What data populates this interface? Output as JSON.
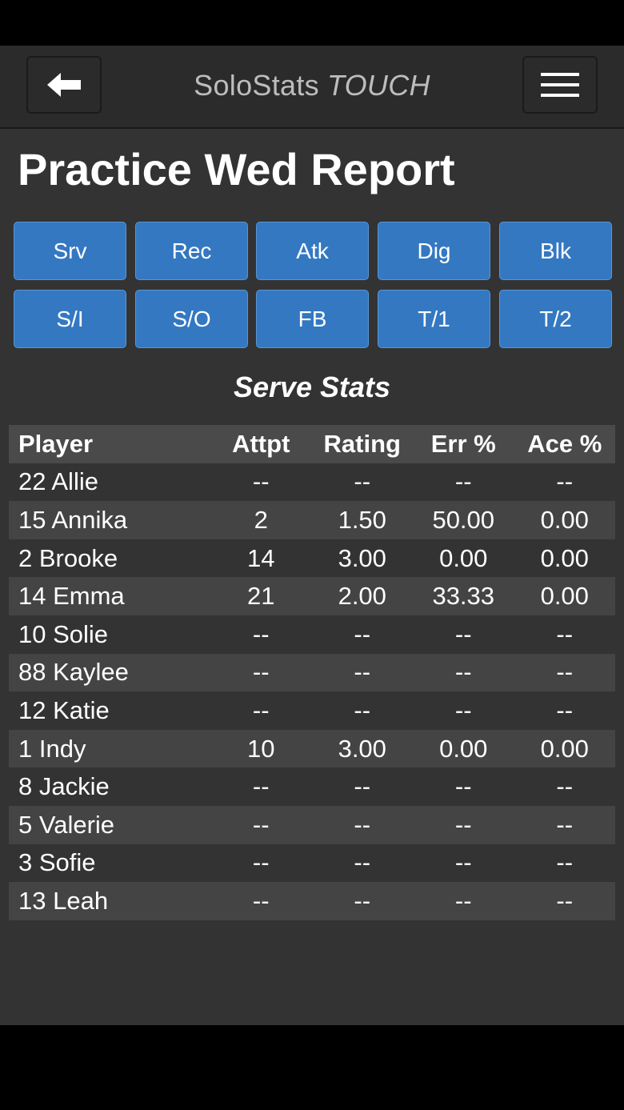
{
  "header": {
    "app_name": "SoloStats",
    "app_name_accent": "TOUCH",
    "back_icon": "arrow-left-icon",
    "menu_icon": "hamburger-icon"
  },
  "page": {
    "title": "Practice Wed Report"
  },
  "tabs": [
    {
      "label": "Srv"
    },
    {
      "label": "Rec"
    },
    {
      "label": "Atk"
    },
    {
      "label": "Dig"
    },
    {
      "label": "Blk"
    },
    {
      "label": "S/I"
    },
    {
      "label": "S/O"
    },
    {
      "label": "FB"
    },
    {
      "label": "T/1"
    },
    {
      "label": "T/2"
    }
  ],
  "section": {
    "title": "Serve Stats"
  },
  "table": {
    "columns": [
      "Player",
      "Attpt",
      "Rating",
      "Err %",
      "Ace %"
    ],
    "rows": [
      [
        "22 Allie",
        "--",
        "--",
        "--",
        "--"
      ],
      [
        "15 Annika",
        "2",
        "1.50",
        "50.00",
        "0.00"
      ],
      [
        "2 Brooke",
        "14",
        "3.00",
        "0.00",
        "0.00"
      ],
      [
        "14 Emma",
        "21",
        "2.00",
        "33.33",
        "0.00"
      ],
      [
        "10 Solie",
        "--",
        "--",
        "--",
        "--"
      ],
      [
        "88 Kaylee",
        "--",
        "--",
        "--",
        "--"
      ],
      [
        "12 Katie",
        "--",
        "--",
        "--",
        "--"
      ],
      [
        "1 Indy",
        "10",
        "3.00",
        "0.00",
        "0.00"
      ],
      [
        "8 Jackie",
        "--",
        "--",
        "--",
        "--"
      ],
      [
        "5 Valerie",
        "--",
        "--",
        "--",
        "--"
      ],
      [
        "3 Sofie",
        "--",
        "--",
        "--",
        "--"
      ],
      [
        "13 Leah",
        "--",
        "--",
        "--",
        "--"
      ]
    ]
  },
  "colors": {
    "tab_blue": "#3478c2",
    "background": "#333333",
    "header": "#2b2b2b"
  }
}
